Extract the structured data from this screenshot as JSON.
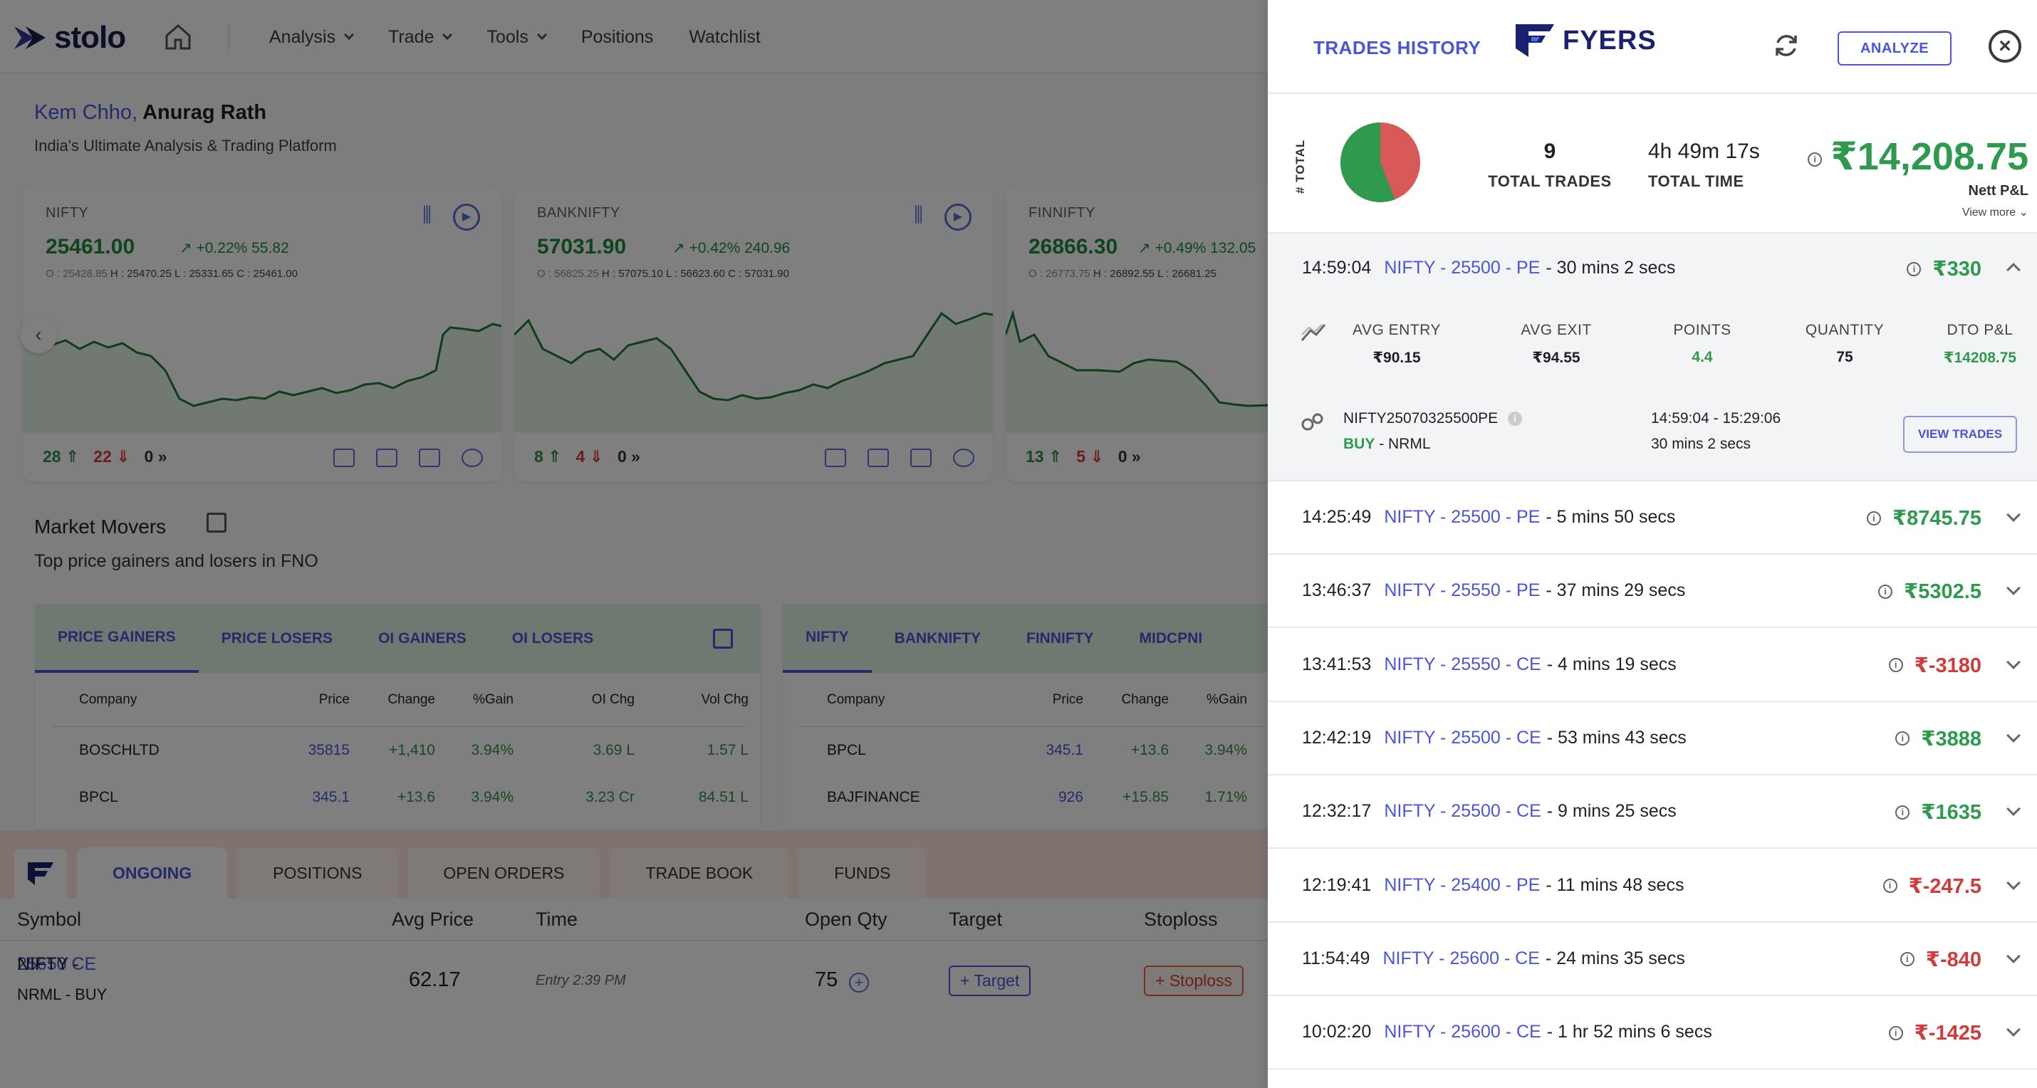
{
  "app": {
    "logo": "stolo",
    "nav": [
      "Analysis",
      "Trade",
      "Tools",
      "Positions",
      "Watchlist"
    ],
    "greeting_hi": "Kem Chho,",
    "greeting_name": "Anurag Rath",
    "tagline": "India's Ultimate Analysis & Trading Platform"
  },
  "cards": [
    {
      "name": "NIFTY",
      "price": "25461.00",
      "change": "+0.22% 55.82",
      "o": "25428.85",
      "h": "25470.25",
      "l": "25331.65",
      "c": "25461.00",
      "up": "28",
      "down": "22",
      "zero": "0"
    },
    {
      "name": "BANKNIFTY",
      "price": "57031.90",
      "change": "+0.42% 240.96",
      "o": "56825.25",
      "h": "57075.10",
      "l": "56623.60",
      "c": "57031.90",
      "up": "8",
      "down": "4",
      "zero": "0"
    },
    {
      "name": "FINNIFTY",
      "price": "26866.30",
      "change": "+0.49% 132.05",
      "o": "26773.75",
      "h": "26892.55",
      "l": "26681.25",
      "c": "",
      "up": "13",
      "down": "5",
      "zero": "0"
    }
  ],
  "market_movers": {
    "title": "Market Movers",
    "subtitle": "Top price gainers and losers in FNO",
    "left_tabs": [
      "PRICE GAINERS",
      "PRICE LOSERS",
      "OI GAINERS",
      "OI LOSERS"
    ],
    "left_headers": [
      "Company",
      "Price",
      "Change",
      "%Gain",
      "OI Chg",
      "Vol Chg"
    ],
    "left_rows": [
      [
        "BOSCHLTD",
        "35815",
        "+1,410",
        "3.94%",
        "3.69 L",
        "1.57 L"
      ],
      [
        "BPCL",
        "345.1",
        "+13.6",
        "3.94%",
        "3.23 Cr",
        "84.51 L"
      ]
    ],
    "right_tabs": [
      "NIFTY",
      "BANKNIFTY",
      "FINNIFTY",
      "MIDCPNI"
    ],
    "right_headers": [
      "Company",
      "Price",
      "Change",
      "%Gain"
    ],
    "right_rows": [
      [
        "BPCL",
        "345.1",
        "+13.6",
        "3.94%"
      ],
      [
        "BAJFINANCE",
        "926",
        "+15.85",
        "1.71%"
      ]
    ]
  },
  "bottom": {
    "tabs": [
      "ONGOING",
      "POSITIONS",
      "OPEN ORDERS",
      "TRADE BOOK",
      "FUNDS"
    ],
    "headers": [
      "Symbol",
      "Avg Price",
      "Time",
      "Open Qty",
      "Target",
      "Stoploss"
    ],
    "row": {
      "sym_a": "NIFTY -",
      "sym_b": "25650 CE",
      "sub": "NRML - BUY",
      "avg": "62.17",
      "time": "Entry 2:39 PM",
      "qty": "75",
      "target": "+ Target",
      "stoploss": "+ Stoploss"
    }
  },
  "drawer": {
    "title": "TRADES HISTORY",
    "broker": "FYERS",
    "analyze": "ANALYZE",
    "total_label": "# TOTAL",
    "total_trades": "9",
    "total_trades_label": "TOTAL TRADES",
    "total_time": "4h 49m 17s",
    "total_time_label": "TOTAL TIME",
    "nett": "₹14,208.75",
    "nett_label": "Nett P&L",
    "view_more": "View more",
    "pie": {
      "win_fraction": 0.56
    },
    "expanded": {
      "time": "14:59:04",
      "symbol": "NIFTY - 25500 - PE",
      "duration": "- 30 mins 2 secs",
      "amount": "₹330",
      "avg_entry_label": "AVG ENTRY",
      "avg_entry": "₹90.15",
      "avg_exit_label": "AVG EXIT",
      "avg_exit": "₹94.55",
      "points_label": "POINTS",
      "points": "4.4",
      "quantity_label": "QUANTITY",
      "quantity": "75",
      "dto_label": "DTO P&L",
      "dto": "₹14208.75",
      "instrument": "NIFTY25070325500PE",
      "side": "BUY",
      "product": "- NRML",
      "range": "14:59:04 - 15:29:06",
      "range_dur": "30 mins 2 secs",
      "view_trades": "VIEW TRADES"
    },
    "trades": [
      {
        "time": "14:25:49",
        "symbol": "NIFTY - 25500 - PE",
        "duration": "- 5 mins 50 secs",
        "amount": "₹8745.75",
        "color": "g"
      },
      {
        "time": "13:46:37",
        "symbol": "NIFTY - 25550 - PE",
        "duration": "- 37 mins 29 secs",
        "amount": "₹5302.5",
        "color": "g"
      },
      {
        "time": "13:41:53",
        "symbol": "NIFTY - 25550 - CE",
        "duration": "- 4 mins 19 secs",
        "amount": "₹-3180",
        "color": "r"
      },
      {
        "time": "12:42:19",
        "symbol": "NIFTY - 25500 - CE",
        "duration": "- 53 mins 43 secs",
        "amount": "₹3888",
        "color": "g"
      },
      {
        "time": "12:32:17",
        "symbol": "NIFTY - 25500 - CE",
        "duration": "- 9 mins 25 secs",
        "amount": "₹1635",
        "color": "g"
      },
      {
        "time": "12:19:41",
        "symbol": "NIFTY - 25400 - PE",
        "duration": "- 11 mins 48 secs",
        "amount": "₹-247.5",
        "color": "r"
      },
      {
        "time": "11:54:49",
        "symbol": "NIFTY - 25600 - CE",
        "duration": "- 24 mins 35 secs",
        "amount": "₹-840",
        "color": "r"
      },
      {
        "time": "10:02:20",
        "symbol": "NIFTY - 25600 - CE",
        "duration": "- 1 hr 52 mins 6 secs",
        "amount": "₹-1425",
        "color": "r"
      }
    ]
  }
}
